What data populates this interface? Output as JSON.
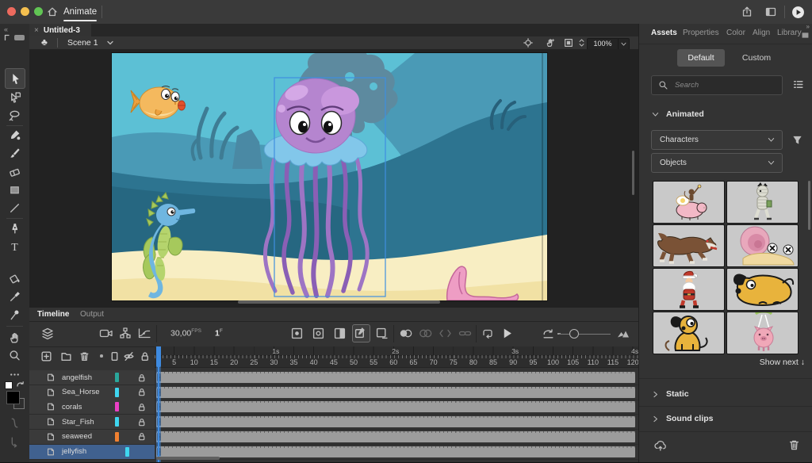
{
  "window": {
    "app_tab": "Animate",
    "traffic_lights": {
      "close": "#ED6A5E",
      "minimize": "#F4BF4F",
      "zoom": "#61C554"
    }
  },
  "doc": {
    "tab_title": "Untitled-3",
    "close_glyph": "×"
  },
  "breadcrumb": {
    "scene": "Scene 1",
    "zoom_level": "100%"
  },
  "toolbar_tools": [
    "selection",
    "subselection",
    "lasso",
    "fluid-brush",
    "classic-brush",
    "eraser",
    "rectangle",
    "line",
    "pen",
    "text",
    "paint-bucket",
    "eyedropper",
    "asset-warp",
    "hand",
    "zoom",
    "more-tools"
  ],
  "stage": {
    "selection_target": "jellyfish",
    "characters": [
      "pufferfish",
      "jellyfish",
      "seahorse",
      "starfish"
    ],
    "colors": {
      "water": "#5cc0d5",
      "mid_hill": "#4a9ab6",
      "dark_hill": "#2d7490",
      "sand_light": "#f8eec3",
      "sand_dark": "#f1e1a4",
      "jellyfish": "#b585cf",
      "selection_box": "#3f8fe0"
    }
  },
  "timeline": {
    "tabs": [
      {
        "label": "Timeline",
        "active": true
      },
      {
        "label": "Output",
        "active": false
      }
    ],
    "fps": "30,00",
    "fps_unit": "FPS",
    "current_frame": "1",
    "frame_unit": "F",
    "ruler": {
      "numbers": [
        5,
        10,
        15,
        20,
        25,
        30,
        35,
        40,
        45,
        50,
        55,
        60,
        65,
        70,
        75,
        80,
        85,
        90,
        95,
        100,
        105,
        110,
        115,
        120
      ],
      "seconds": [
        {
          "label": "1s",
          "frame": 30
        },
        {
          "label": "2s",
          "frame": 60
        },
        {
          "label": "3s",
          "frame": 90
        },
        {
          "label": "4s",
          "frame": 120
        }
      ]
    },
    "layers": [
      {
        "name": "angelfish",
        "color": "#2aa79b",
        "locked": true,
        "selected": false
      },
      {
        "name": "Sea_Horse",
        "color": "#3fd6f0",
        "locked": true,
        "selected": false
      },
      {
        "name": "corals",
        "color": "#ea3fc4",
        "locked": true,
        "selected": false
      },
      {
        "name": "Star_Fish",
        "color": "#3fd6f0",
        "locked": true,
        "selected": false
      },
      {
        "name": "seaweed",
        "color": "#f08030",
        "locked": true,
        "selected": false
      },
      {
        "name": "jellyfish",
        "color": "#3fd6f0",
        "locked": false,
        "selected": true
      }
    ]
  },
  "assets_panel": {
    "tabs": [
      {
        "label": "Assets",
        "active": true
      },
      {
        "label": "Properties",
        "active": false
      },
      {
        "label": "Color",
        "active": false
      },
      {
        "label": "Align",
        "active": false
      },
      {
        "label": "Library",
        "active": false
      }
    ],
    "mode_default": "Default",
    "mode_custom": "Custom",
    "search_placeholder": "Search",
    "section_animated": "Animated",
    "dropdown_characters": "Characters",
    "dropdown_objects": "Objects",
    "show_next": "Show next ↓",
    "section_static": "Static",
    "section_sound": "Sound clips",
    "thumbnails": [
      "monkey-riding-pig",
      "mummy",
      "wolf",
      "snail-knocked-out",
      "santa-claus",
      "dog-lying",
      "dog-sitting",
      "pig-parachute"
    ]
  }
}
